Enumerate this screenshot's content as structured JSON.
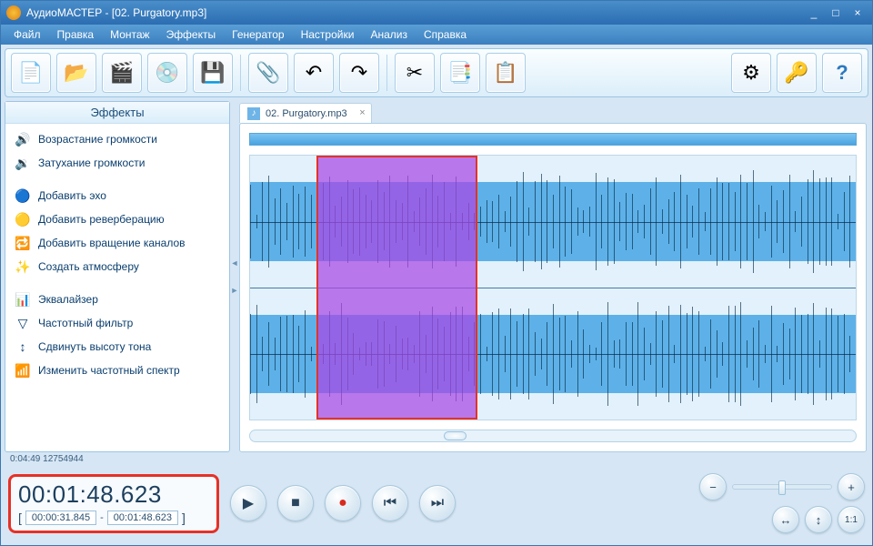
{
  "window": {
    "title": "АудиоМАСТЕР - [02. Purgatory.mp3]"
  },
  "menu": {
    "items": [
      "Файл",
      "Правка",
      "Монтаж",
      "Эффекты",
      "Генератор",
      "Настройки",
      "Анализ",
      "Справка"
    ]
  },
  "sidebar": {
    "title": "Эффекты",
    "items": [
      {
        "icon": "🔊",
        "label": "Возрастание громкости"
      },
      {
        "icon": "🔉",
        "label": "Затухание громкости"
      },
      {
        "gap": true
      },
      {
        "icon": "🔵",
        "label": "Добавить эхо"
      },
      {
        "icon": "🟡",
        "label": "Добавить реверберацию"
      },
      {
        "icon": "🔁",
        "label": "Добавить вращение каналов"
      },
      {
        "icon": "✨",
        "label": "Создать атмосферу"
      },
      {
        "gap": true
      },
      {
        "icon": "📊",
        "label": "Эквалайзер"
      },
      {
        "icon": "▽",
        "label": "Частотный фильтр"
      },
      {
        "icon": "↕",
        "label": "Сдвинуть высоту тона"
      },
      {
        "icon": "📶",
        "label": "Изменить частотный спектр"
      }
    ]
  },
  "tab": {
    "label": "02. Purgatory.mp3"
  },
  "status": {
    "text": "0:04:49 12754944"
  },
  "time": {
    "current": "00:01:48.623",
    "sel_start": "00:00:31.845",
    "sel_end": "00:01:48.623",
    "dash": "-"
  },
  "selection": {
    "left_pct": 10.9,
    "width_pct": 26.6
  },
  "toolbar_icons": {
    "new": "📄",
    "open": "📂",
    "video": "🎬",
    "cd": "💿",
    "save": "💾",
    "mix": "📎",
    "undo": "↶",
    "redo": "↷",
    "cut": "✂",
    "copy": "📑",
    "paste": "📋",
    "settings": "⚙",
    "key": "🔑",
    "help": "?"
  },
  "zoom_icons": {
    "minus": "−",
    "plus": "+",
    "fit_h": "↔",
    "fit_v": "↕",
    "one_one": "1:1"
  },
  "transport_icons": {
    "play": "▶",
    "stop": "■",
    "record": "●",
    "prev": "⏮",
    "next": "⏭"
  }
}
